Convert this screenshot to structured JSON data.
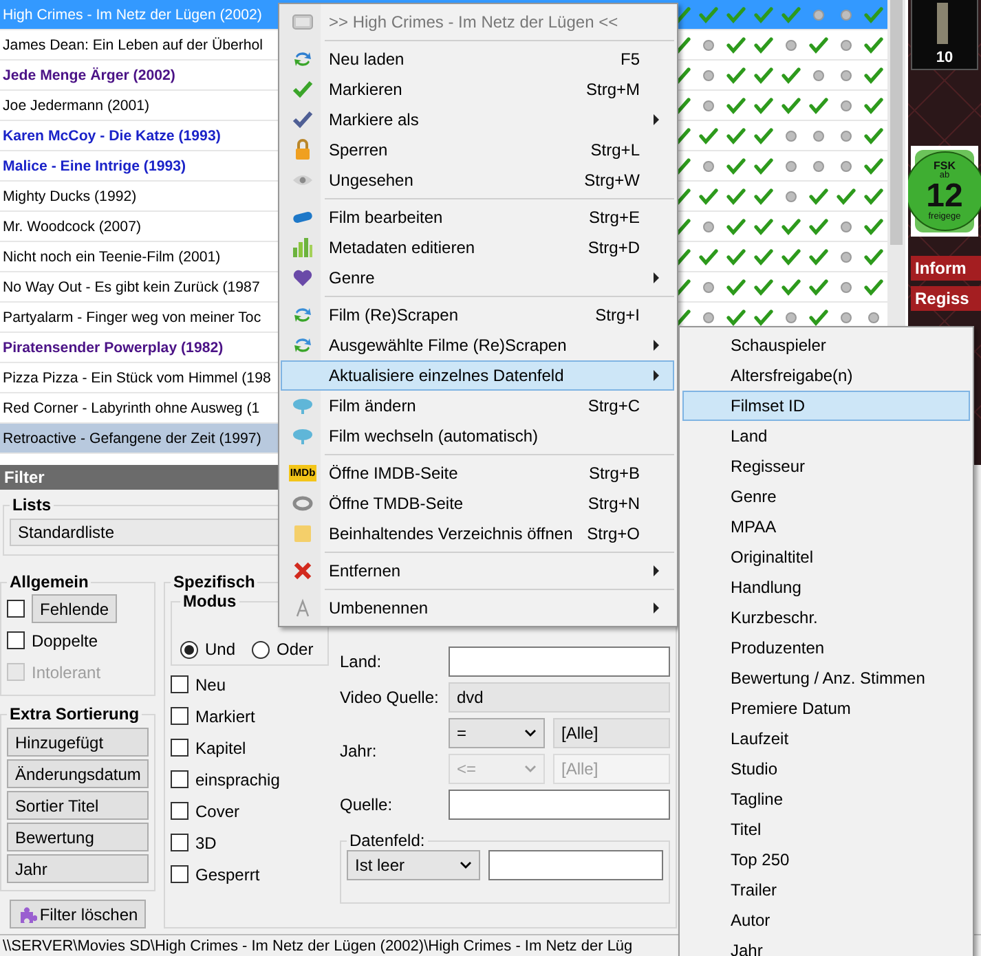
{
  "movie_list": {
    "rows": [
      {
        "title": "High Crimes - Im Netz der Lügen (2002)",
        "selected": true,
        "hovered": false,
        "bold": false,
        "color": "#ffffff",
        "flags": [
          true,
          true,
          true,
          true,
          true,
          false,
          false,
          true
        ]
      },
      {
        "title": "James Dean: Ein Leben auf der Überhol",
        "selected": false,
        "hovered": false,
        "bold": false,
        "color": "#000000",
        "flags": [
          true,
          false,
          true,
          true,
          false,
          true,
          false,
          true
        ]
      },
      {
        "title": "Jede Menge Ärger (2002)",
        "selected": false,
        "hovered": false,
        "bold": true,
        "color": "#4b1286",
        "flags": [
          true,
          false,
          true,
          true,
          true,
          false,
          false,
          true
        ]
      },
      {
        "title": "Joe Jedermann (2001)",
        "selected": false,
        "hovered": false,
        "bold": false,
        "color": "#000000",
        "flags": [
          true,
          false,
          true,
          true,
          true,
          true,
          false,
          true
        ]
      },
      {
        "title": "Karen McCoy - Die Katze (1993)",
        "selected": false,
        "hovered": false,
        "bold": true,
        "color": "#1a22c8",
        "flags": [
          true,
          true,
          true,
          true,
          false,
          false,
          false,
          true
        ]
      },
      {
        "title": "Malice - Eine Intrige (1993)",
        "selected": false,
        "hovered": false,
        "bold": true,
        "color": "#1a22c8",
        "flags": [
          true,
          false,
          true,
          true,
          false,
          false,
          false,
          true
        ]
      },
      {
        "title": "Mighty Ducks (1992)",
        "selected": false,
        "hovered": false,
        "bold": false,
        "color": "#000000",
        "flags": [
          true,
          true,
          true,
          true,
          false,
          true,
          true,
          true
        ]
      },
      {
        "title": "Mr. Woodcock (2007)",
        "selected": false,
        "hovered": false,
        "bold": false,
        "color": "#000000",
        "flags": [
          true,
          false,
          true,
          true,
          true,
          true,
          false,
          true
        ]
      },
      {
        "title": "Nicht noch ein Teenie-Film (2001)",
        "selected": false,
        "hovered": false,
        "bold": false,
        "color": "#000000",
        "flags": [
          true,
          true,
          true,
          true,
          true,
          true,
          false,
          true
        ]
      },
      {
        "title": "No Way Out - Es gibt kein Zurück (1987",
        "selected": false,
        "hovered": false,
        "bold": false,
        "color": "#000000",
        "flags": [
          true,
          false,
          true,
          true,
          true,
          true,
          false,
          true
        ]
      },
      {
        "title": "Partyalarm - Finger weg von meiner Toc",
        "selected": false,
        "hovered": false,
        "bold": false,
        "color": "#000000",
        "flags": [
          true,
          false,
          true,
          true,
          false,
          true,
          false,
          false
        ]
      },
      {
        "title": "Piratensender Powerplay (1982)",
        "selected": false,
        "hovered": false,
        "bold": true,
        "color": "#4b1286"
      },
      {
        "title": "Pizza Pizza - Ein Stück vom Himmel (198",
        "selected": false,
        "hovered": false,
        "bold": false,
        "color": "#000000"
      },
      {
        "title": "Red Corner - Labyrinth ohne Ausweg (1",
        "selected": false,
        "hovered": false,
        "bold": false,
        "color": "#000000"
      },
      {
        "title": "Retroactive - Gefangene der Zeit (1997)",
        "selected": false,
        "hovered": true,
        "bold": false,
        "color": "#000000"
      }
    ]
  },
  "side_panel": {
    "poster_caption": "10",
    "rating_badge": {
      "top": "FSK",
      "middle": "ab",
      "number": "12",
      "bottom": "freigege"
    },
    "section_labels": [
      "Inform",
      "Regiss"
    ]
  },
  "filter": {
    "title": "Filter",
    "lists": {
      "legend": "Lists",
      "value": "Standardliste"
    },
    "general": {
      "legend": "Allgemein",
      "options": [
        {
          "kind": "button",
          "label": "Fehlende",
          "checked": false,
          "disabled": false
        },
        {
          "kind": "plain",
          "label": "Doppelte",
          "checked": false,
          "disabled": false
        },
        {
          "kind": "plain",
          "label": "Intolerant",
          "checked": false,
          "disabled": true
        }
      ]
    },
    "extra_sort": {
      "legend": "Extra Sortierung",
      "buttons": [
        "Hinzugefügt",
        "Änderungsdatum",
        "Sortier Titel",
        "Bewertung",
        "Jahr"
      ]
    },
    "clear_button": "Filter löschen",
    "specific": {
      "legend": "Spezifisch",
      "mode": {
        "legend": "Modus",
        "options": [
          {
            "label": "Und",
            "selected": true
          },
          {
            "label": "Oder",
            "selected": false
          }
        ]
      },
      "flags": [
        {
          "label": "Neu",
          "checked": false
        },
        {
          "label": "Markiert",
          "checked": false
        },
        {
          "label": "Kapitel",
          "checked": false
        },
        {
          "label": "einsprachig",
          "checked": false
        },
        {
          "label": "Cover",
          "checked": false
        },
        {
          "label": "3D",
          "checked": false
        },
        {
          "label": "Gesperrt",
          "checked": false
        }
      ],
      "land": {
        "label": "Land:"
      },
      "video_source": {
        "label": "Video Quelle:",
        "value": "dvd"
      },
      "year": {
        "label": "Jahr:",
        "rows": [
          {
            "operator": "=",
            "value": "[Alle]",
            "disabled": false
          },
          {
            "operator": "<=",
            "value": "[Alle]",
            "disabled": true
          }
        ]
      },
      "source": {
        "label": "Quelle:"
      },
      "data_field": {
        "legend": "Datenfeld:",
        "condition": "Ist leer"
      }
    }
  },
  "status_bar": {
    "path": "\\\\SERVER\\Movies SD\\High Crimes - Im Netz der Lügen (2002)\\High Crimes - Im Netz der Lüg"
  },
  "context_menu": {
    "groups": [
      {
        "items": [
          {
            "kind": "header",
            "label": ">> High Crimes - Im Netz der Lügen <<",
            "selected": false
          }
        ]
      },
      {
        "items": [
          {
            "kind": "item",
            "label": "Neu laden",
            "shortcut": "F5",
            "selected": false
          },
          {
            "kind": "item",
            "label": "Markieren",
            "shortcut": "Strg+M",
            "selected": false
          },
          {
            "kind": "item",
            "label": "Markiere als",
            "submenu": true,
            "selected": false
          },
          {
            "kind": "item",
            "label": "Sperren",
            "shortcut": "Strg+L",
            "selected": false
          },
          {
            "kind": "item",
            "label": "Ungesehen",
            "shortcut": "Strg+W",
            "selected": false
          }
        ]
      },
      {
        "items": [
          {
            "kind": "item",
            "label": "Film bearbeiten",
            "shortcut": "Strg+E",
            "selected": false
          },
          {
            "kind": "item",
            "label": "Metadaten editieren",
            "shortcut": "Strg+D",
            "selected": false
          },
          {
            "kind": "item",
            "label": "Genre",
            "submenu": true,
            "selected": false
          }
        ]
      },
      {
        "items": [
          {
            "kind": "item",
            "label": "Film (Re)Scrapen",
            "shortcut": "Strg+I",
            "selected": false
          },
          {
            "kind": "item",
            "label": "Ausgewählte Filme (Re)Scrapen",
            "submenu": true,
            "selected": false
          },
          {
            "kind": "item",
            "label": "Aktualisiere einzelnes Datenfeld",
            "submenu": true,
            "selected": true
          },
          {
            "kind": "item",
            "label": "Film ändern",
            "shortcut": "Strg+C",
            "selected": false
          },
          {
            "kind": "item",
            "label": "Film wechseln (automatisch)",
            "selected": false
          }
        ]
      },
      {
        "items": [
          {
            "kind": "item",
            "label": "Öffne IMDB-Seite",
            "shortcut": "Strg+B",
            "badge": "IMDb",
            "selected": false
          },
          {
            "kind": "item",
            "label": "Öffne TMDB-Seite",
            "shortcut": "Strg+N",
            "selected": false
          },
          {
            "kind": "item",
            "label": "Beinhaltendes Verzeichnis öffnen",
            "shortcut": "Strg+O",
            "selected": false
          }
        ]
      },
      {
        "items": [
          {
            "kind": "item",
            "label": "Entfernen",
            "submenu": true,
            "selected": false
          }
        ]
      },
      {
        "items": [
          {
            "kind": "item",
            "label": "Umbenennen",
            "submenu": true,
            "selected": false
          }
        ]
      }
    ]
  },
  "submenu": {
    "items": [
      {
        "label": "Schauspieler",
        "selected": false
      },
      {
        "label": "Altersfreigabe(n)",
        "selected": false
      },
      {
        "label": "Filmset ID",
        "selected": true
      },
      {
        "label": "Land",
        "selected": false
      },
      {
        "label": "Regisseur",
        "selected": false
      },
      {
        "label": "Genre",
        "selected": false
      },
      {
        "label": "MPAA",
        "selected": false
      },
      {
        "label": "Originaltitel",
        "selected": false
      },
      {
        "label": "Handlung",
        "selected": false
      },
      {
        "label": "Kurzbeschr.",
        "selected": false
      },
      {
        "label": "Produzenten",
        "selected": false
      },
      {
        "label": "Bewertung / Anz. Stimmen",
        "selected": false
      },
      {
        "label": "Premiere Datum",
        "selected": false
      },
      {
        "label": "Laufzeit",
        "selected": false
      },
      {
        "label": "Studio",
        "selected": false
      },
      {
        "label": "Tagline",
        "selected": false
      },
      {
        "label": "Titel",
        "selected": false
      },
      {
        "label": "Top 250",
        "selected": false
      },
      {
        "label": "Trailer",
        "selected": false
      },
      {
        "label": "Autor",
        "selected": false
      },
      {
        "label": "Jahr",
        "selected": false
      }
    ]
  }
}
